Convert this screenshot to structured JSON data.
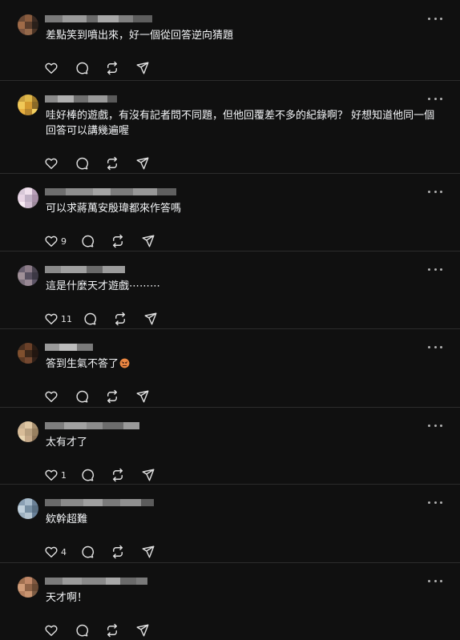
{
  "replies": [
    {
      "text": "差點笑到噴出來，好一個從回答逆向猜題",
      "likes": "",
      "emoji": ""
    },
    {
      "text": "哇好棒的遊戲，有沒有記者問不同題，但他回覆差不多的紀錄啊？ 好想知道他同一個回答可以講幾遍喔",
      "likes": "",
      "emoji": ""
    },
    {
      "text": "可以求蔣萬安殷瑋都來作答嗎",
      "likes": "9",
      "emoji": ""
    },
    {
      "text": "這是什麼天才遊戲⋯⋯⋯",
      "likes": "11",
      "emoji": ""
    },
    {
      "text": "答到生氣不答了",
      "likes": "",
      "emoji": "angry-face"
    },
    {
      "text": "太有才了",
      "likes": "1",
      "emoji": ""
    },
    {
      "text": "欸幹超難",
      "likes": "4",
      "emoji": ""
    },
    {
      "text": "天才啊！",
      "likes": "",
      "emoji": ""
    }
  ],
  "icons": {
    "like": "heart-icon",
    "reply": "comment-icon",
    "repost": "repost-icon",
    "share": "share-icon",
    "more": "more-options-icon"
  },
  "colors": {
    "background": "#101010",
    "divider": "#2c2c2c",
    "text": "#f3f5f7",
    "icon": "#e0e0e0"
  }
}
